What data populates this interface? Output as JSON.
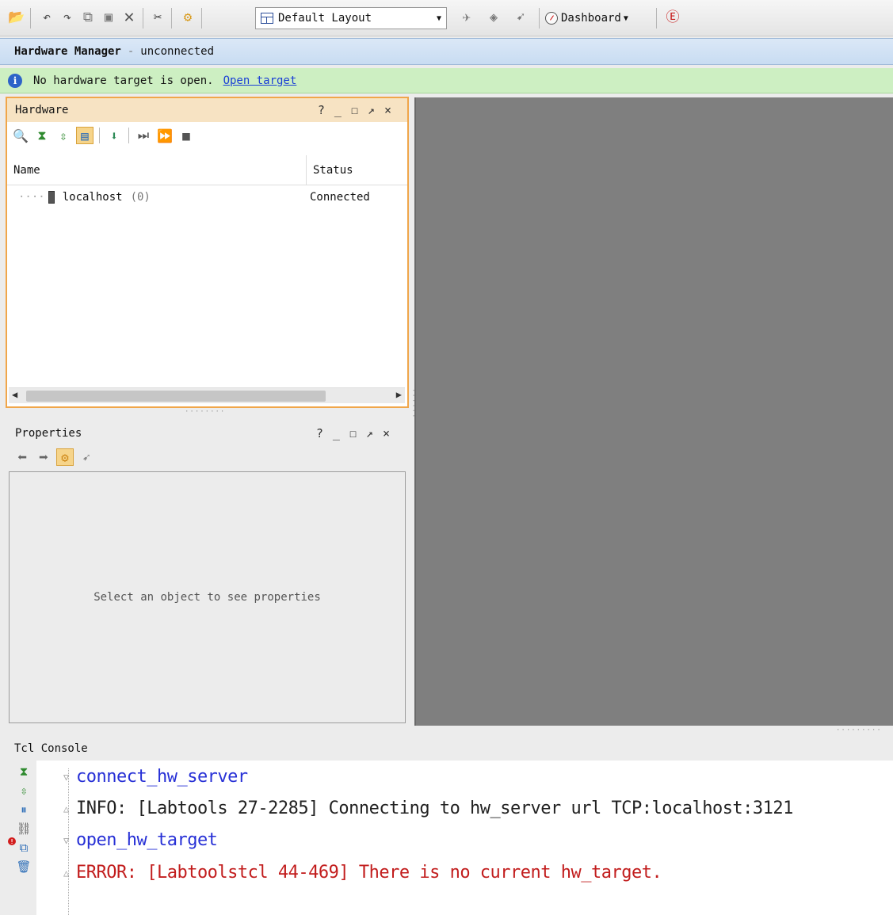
{
  "toolbar": {
    "icons": [
      "open-project-icon",
      "undo-icon",
      "redo-icon",
      "copy-icon",
      "paste-icon",
      "delete-icon",
      "settings-tools-icon",
      "run-icon",
      "autoconnect-icon",
      "program-icon",
      "pointer-icon",
      "help-icon"
    ],
    "layout_select": "Default Layout",
    "dashboard_label": "Dashboard"
  },
  "titlebar": {
    "title": "Hardware Manager",
    "separator": "-",
    "status": "unconnected"
  },
  "infobar": {
    "message": "No hardware target is open.",
    "link": "Open target"
  },
  "hardware_panel": {
    "title": "Hardware",
    "controls": [
      "?",
      "_",
      "☐",
      "↗",
      "×"
    ],
    "columns": [
      "Name",
      "Status"
    ],
    "rows": [
      {
        "name": "localhost",
        "count": "(0)",
        "status": "Connected"
      }
    ]
  },
  "properties_panel": {
    "title": "Properties",
    "empty_message": "Select an object to see properties"
  },
  "tcl_console": {
    "title": "Tcl Console",
    "lines": [
      {
        "type": "cmd",
        "text": "connect_hw_server"
      },
      {
        "type": "info",
        "text": "INFO: [Labtools 27-2285] Connecting to hw_server url TCP:localhost:3121"
      },
      {
        "type": "cmd",
        "text": "open_hw_target"
      },
      {
        "type": "err",
        "text": "ERROR: [Labtoolstcl 44-469] There is no current hw_target."
      }
    ]
  },
  "colors": {
    "accent_panel_border": "#f0a64a",
    "info_bar": "#cdefc2",
    "link": "#1a3fd6",
    "cmd_text": "#2730d6",
    "error_text": "#c21d1d"
  }
}
